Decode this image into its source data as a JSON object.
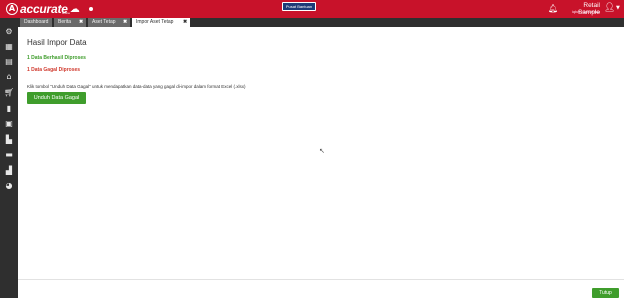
{
  "header": {
    "brand": "accurate",
    "brand_sub": "online",
    "help_label": "Pusat Bantuan",
    "user_name": "Retail Sample",
    "user_sub": "iqbal hamuzdac"
  },
  "icons": {
    "logo": "accurate-logo-icon",
    "bell": "bell-icon",
    "user": "user-icon",
    "caret": "chevron-down-icon"
  },
  "tabs": [
    {
      "label": "Dashboard",
      "closable": false
    },
    {
      "label": "Berita",
      "closable": true
    },
    {
      "label": "Aset Tetap",
      "closable": true
    },
    {
      "label": "Impor Aset Tetap",
      "closable": true,
      "active": true
    }
  ],
  "sidebar": [
    "gear-icon",
    "building-icon",
    "storefront-icon",
    "bank-icon",
    "cart-icon",
    "bag-icon",
    "clipboard-icon",
    "warehouse-icon",
    "truck-icon",
    "factory-icon",
    "pie-chart-icon"
  ],
  "main": {
    "title": "Hasil Impor Data",
    "success_text": "1 Data Berhasil Diproses",
    "fail_text": "1 Data Gagal Diproses",
    "info_text": "Klik tombol \"Unduh Data Gagal\" untuk mendapatkan data-data yang gagal di-impor dalam format Excel (.xlsx)",
    "download_label": "Unduh Data Gagal",
    "close_label": "Tutup"
  },
  "colors": {
    "brand_red": "#c8122a",
    "sidebar_dark": "#2f2f2f",
    "success_green": "#3f9d2c",
    "fail_red": "#d03a2e"
  }
}
